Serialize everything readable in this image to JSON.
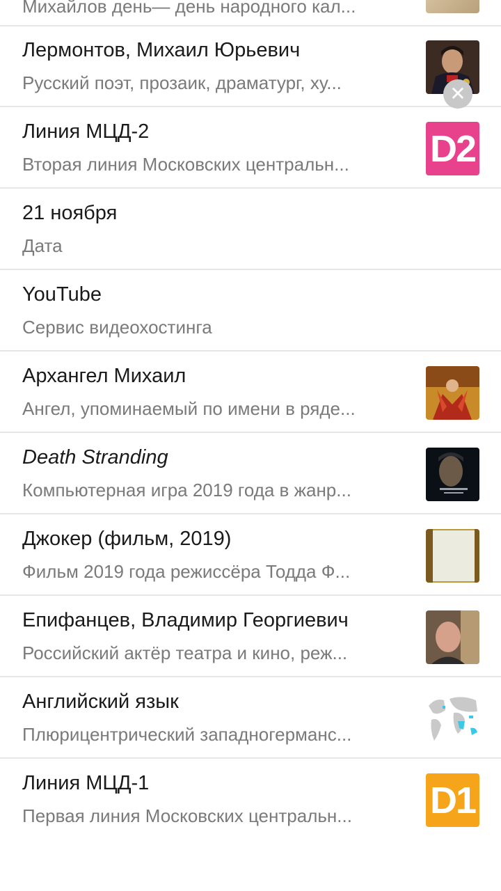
{
  "items": [
    {
      "title": "Михайлов день— день народного кал...",
      "subtitle": "",
      "thumb": "icon-thumb"
    },
    {
      "title": "Лермонтов, Михаил Юрьевич",
      "subtitle": "Русский поэт, прозаик, драматург, ху...",
      "thumb": "portrait"
    },
    {
      "title": "Линия МЦД-2",
      "subtitle": "Вторая линия Московских центральн...",
      "thumb": "d2"
    },
    {
      "title": "21 ноября",
      "subtitle": "Дата",
      "thumb": null
    },
    {
      "title": "YouTube",
      "subtitle": "Сервис видеохостинга",
      "thumb": null
    },
    {
      "title": "Архангел Михаил",
      "subtitle": "Ангел, упоминаемый по имени в ряде...",
      "thumb": "icon"
    },
    {
      "title": "Death Stranding",
      "subtitle": "Компьютерная игра 2019 года в жанр...",
      "thumb": "game"
    },
    {
      "title": "Джокер (фильм, 2019)",
      "subtitle": "Фильм 2019 года режиссёра Тодда Ф...",
      "thumb": "film"
    },
    {
      "title": "Епифанцев, Владимир Георгиевич",
      "subtitle": "Российский актёр театра и кино, реж...",
      "thumb": "actor"
    },
    {
      "title": "Английский язык",
      "subtitle": "Плюрицентрический западногерманс...",
      "thumb": "map"
    },
    {
      "title": "Линия МЦД-1",
      "subtitle": "Первая линия Московских центральн...",
      "thumb": "d1"
    }
  ],
  "badges": {
    "d2": "D2",
    "d1": "D1"
  },
  "close_glyph": "✕"
}
